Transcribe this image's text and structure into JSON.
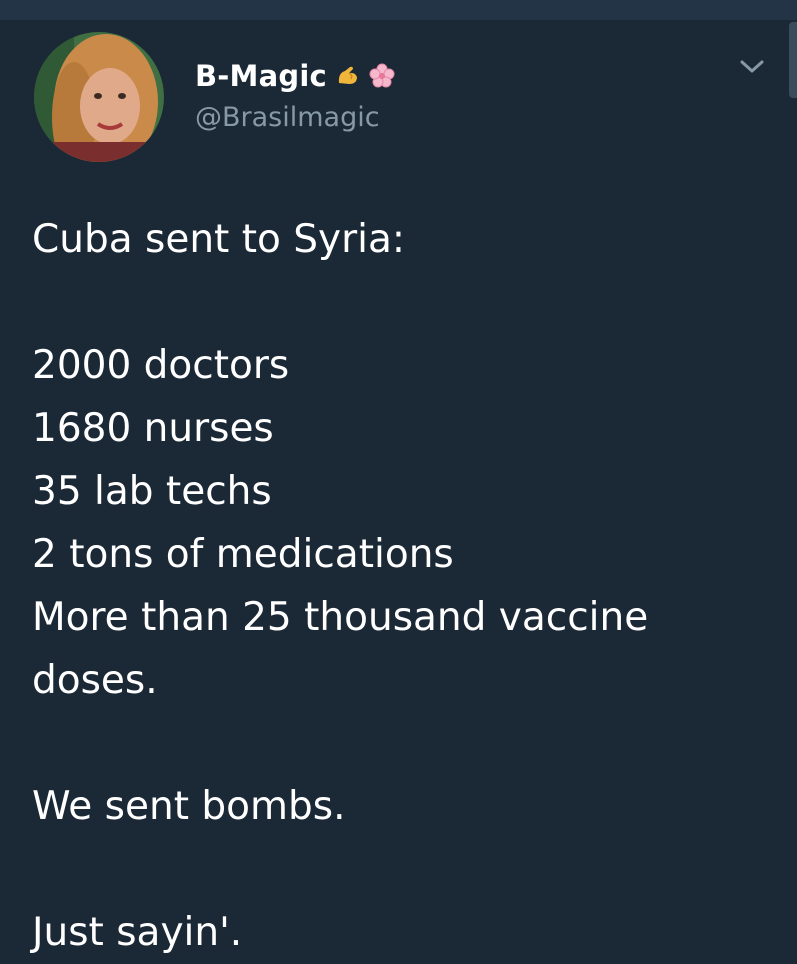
{
  "tweet": {
    "author": {
      "display_name": "B-Magic",
      "handle": "@Brasilmagic",
      "name_icons": [
        "flexed-biceps-icon",
        "cherry-blossom-icon"
      ]
    },
    "menu_icon": "chevron-down-icon",
    "lines": [
      "Cuba sent to Syria:",
      "",
      "2000 doctors",
      "1680 nurses",
      "35 lab techs",
      "2 tons of medications",
      "More than 25 thousand vaccine",
      "doses.",
      "",
      "We sent bombs.",
      "",
      "Just sayin'."
    ]
  },
  "colors": {
    "background": "#1b2836",
    "text": "#ffffff",
    "secondary_text": "#8899a6",
    "top_bar": "#243447"
  }
}
